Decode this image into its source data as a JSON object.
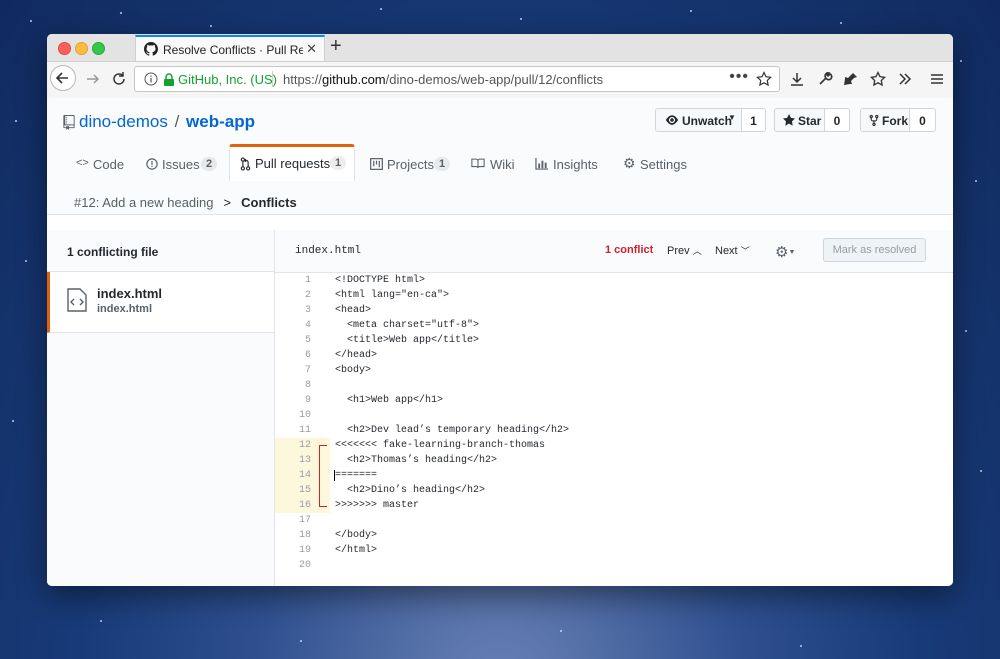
{
  "browser": {
    "tab_title": "Resolve Conflicts · Pull Request",
    "site_identity": "GitHub, Inc. (US)",
    "url_prefix": "https://",
    "url_host": "github.com",
    "url_path": "/dino-demos/web-app/pull/12/conflicts",
    "page_actions": "•••"
  },
  "repo": {
    "owner": "dino-demos",
    "separator": "/",
    "name": "web-app",
    "actions": [
      {
        "label": "Unwatch",
        "count": "1"
      },
      {
        "label": "Star",
        "count": "0"
      },
      {
        "label": "Fork",
        "count": "0"
      }
    ]
  },
  "repo_nav": [
    {
      "label": "Code",
      "icon": "code-icon"
    },
    {
      "label": "Issues",
      "icon": "issue-icon",
      "count": "2"
    },
    {
      "label": "Pull requests",
      "icon": "pull-request-icon",
      "count": "1",
      "selected": true
    },
    {
      "label": "Projects",
      "icon": "project-icon",
      "count": "1"
    },
    {
      "label": "Wiki",
      "icon": "book-icon"
    },
    {
      "label": "Insights",
      "icon": "graph-icon"
    },
    {
      "label": "Settings",
      "icon": "gear-icon"
    }
  ],
  "breadcrumb": {
    "pr": "#12: Add a new heading",
    "separator": ">",
    "current": "Conflicts"
  },
  "sidebar": {
    "header": "1 conflicting file",
    "files": [
      {
        "name": "index.html",
        "path": "index.html"
      }
    ]
  },
  "editor": {
    "filename": "index.html",
    "conflict_count": "1 conflict",
    "prev": "Prev",
    "next": "Next",
    "mark_resolved": "Mark as resolved",
    "conflict_color": "#cb2431",
    "lines": [
      {
        "n": "1",
        "text": "<!DOCTYPE html>"
      },
      {
        "n": "2",
        "text": "<html lang=\"en-ca\">"
      },
      {
        "n": "3",
        "text": "<head>"
      },
      {
        "n": "4",
        "text": "  <meta charset=\"utf-8\">"
      },
      {
        "n": "5",
        "text": "  <title>Web app</title>"
      },
      {
        "n": "6",
        "text": "</head>"
      },
      {
        "n": "7",
        "text": "<body>"
      },
      {
        "n": "8",
        "text": ""
      },
      {
        "n": "9",
        "text": "  <h1>Web app</h1>"
      },
      {
        "n": "10",
        "text": ""
      },
      {
        "n": "11",
        "text": "  <h2>Dev lead’s temporary heading</h2>"
      },
      {
        "n": "12",
        "text": "<<<<<<< fake-learning-branch-thomas",
        "conflict": true
      },
      {
        "n": "13",
        "text": "  <h2>Thomas’s heading</h2>",
        "conflict": true
      },
      {
        "n": "14",
        "text": "=======",
        "conflict": true
      },
      {
        "n": "15",
        "text": "  <h2>Dino’s heading</h2>",
        "conflict": true
      },
      {
        "n": "16",
        "text": ">>>>>>> master",
        "conflict": true
      },
      {
        "n": "17",
        "text": ""
      },
      {
        "n": "18",
        "text": "</body>"
      },
      {
        "n": "19",
        "text": "</html>"
      },
      {
        "n": "20",
        "text": ""
      }
    ]
  }
}
